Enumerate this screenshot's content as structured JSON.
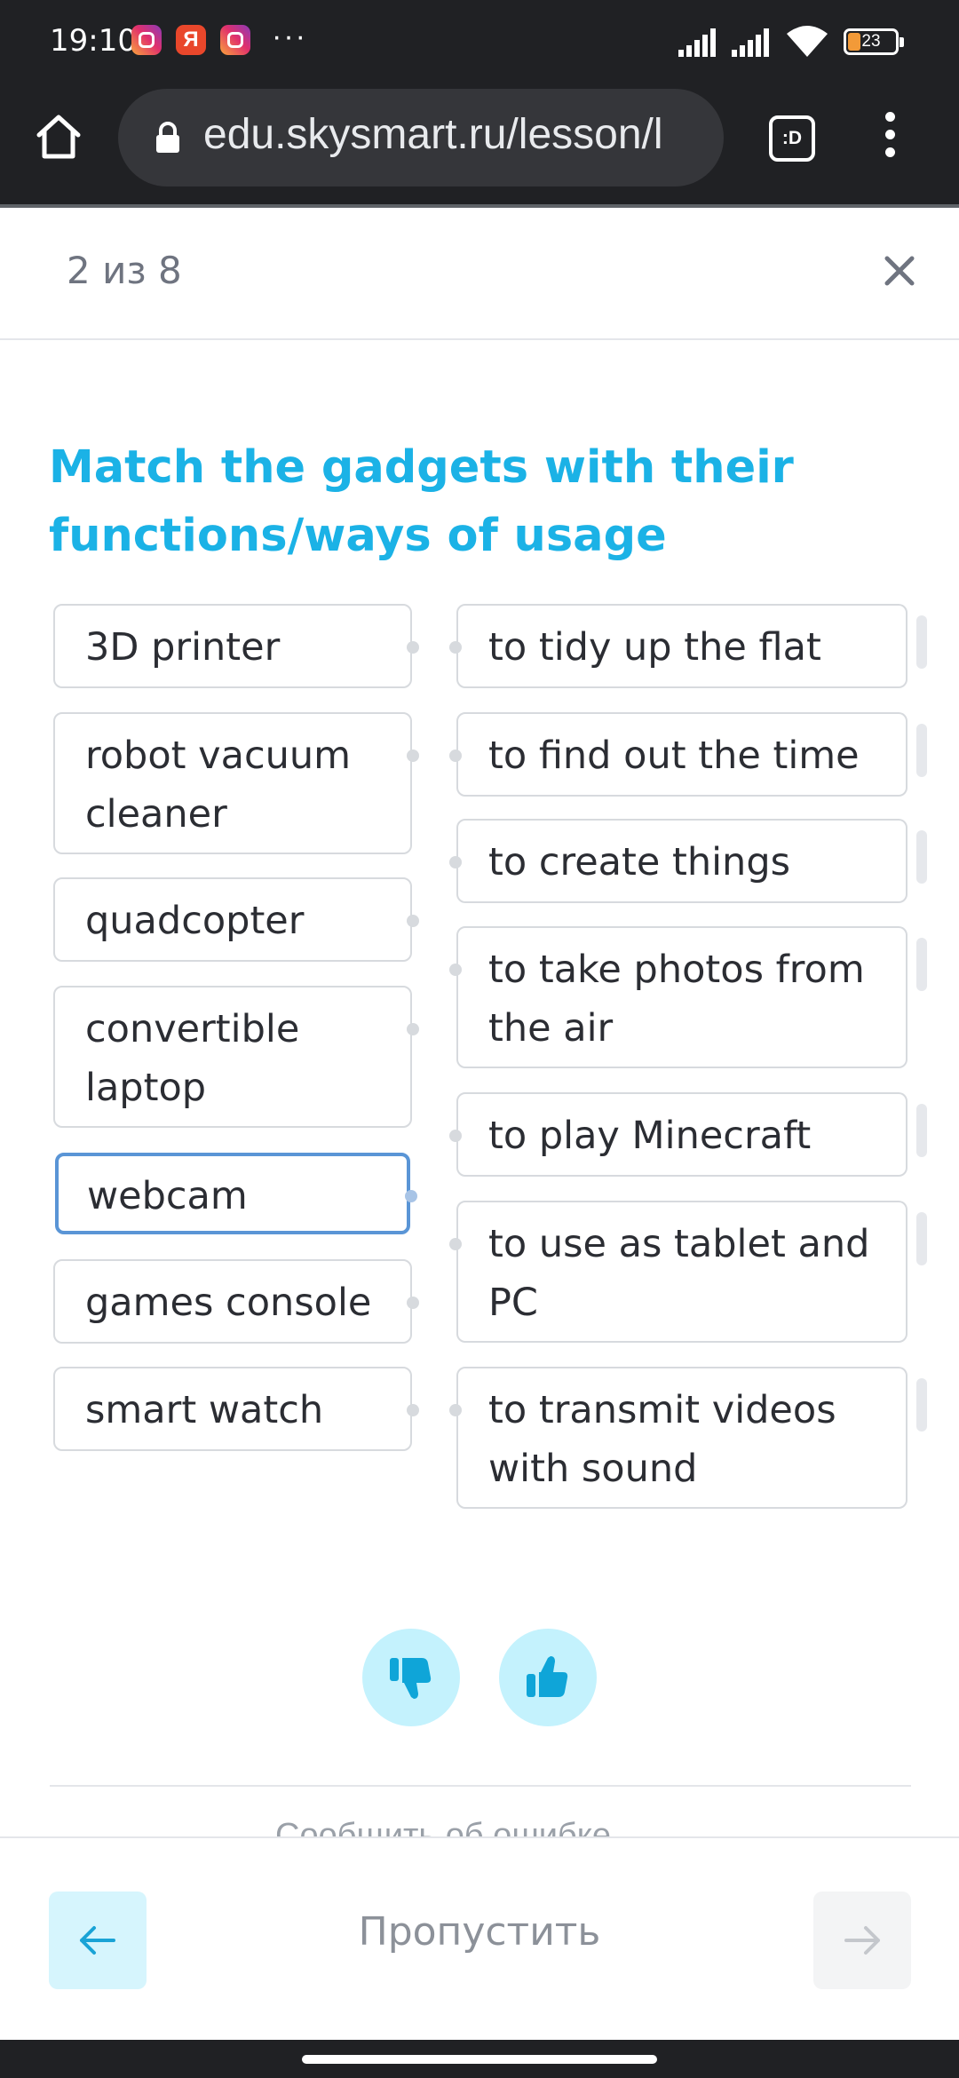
{
  "status_bar": {
    "time": "19:10",
    "apps": [
      "instagram-icon",
      "yandex-icon",
      "instagram-icon"
    ],
    "yandex_letter": "Я",
    "more": "···",
    "battery": "23"
  },
  "browser": {
    "url": "edu.skysmart.ru/lesson/l",
    "tabs_label": ":D"
  },
  "lesson": {
    "progress": "2 из 8",
    "title": "Match the gadgets with their functions/ways of usage",
    "gadgets": [
      "3D printer",
      "robot vacuum cleaner",
      "quadcopter",
      "convertible laptop",
      "webcam",
      "games console",
      "smart watch"
    ],
    "functions": [
      "to tidy up the flat",
      "to find out the time",
      "to create things",
      "to take photos from the air",
      "to play Minecraft",
      "to use as tablet and PC",
      "to transmit videos with sound"
    ],
    "selected_gadget": "webcam"
  },
  "navigation": {
    "skip_label": "Пропустить",
    "cut_text": "Сообщить об ошибке"
  },
  "colors": {
    "accent": "#1bb2e6",
    "selected_border": "#5a95d6",
    "rate_bg": "#c4f2fd",
    "rate_icon": "#0fa5d8"
  }
}
